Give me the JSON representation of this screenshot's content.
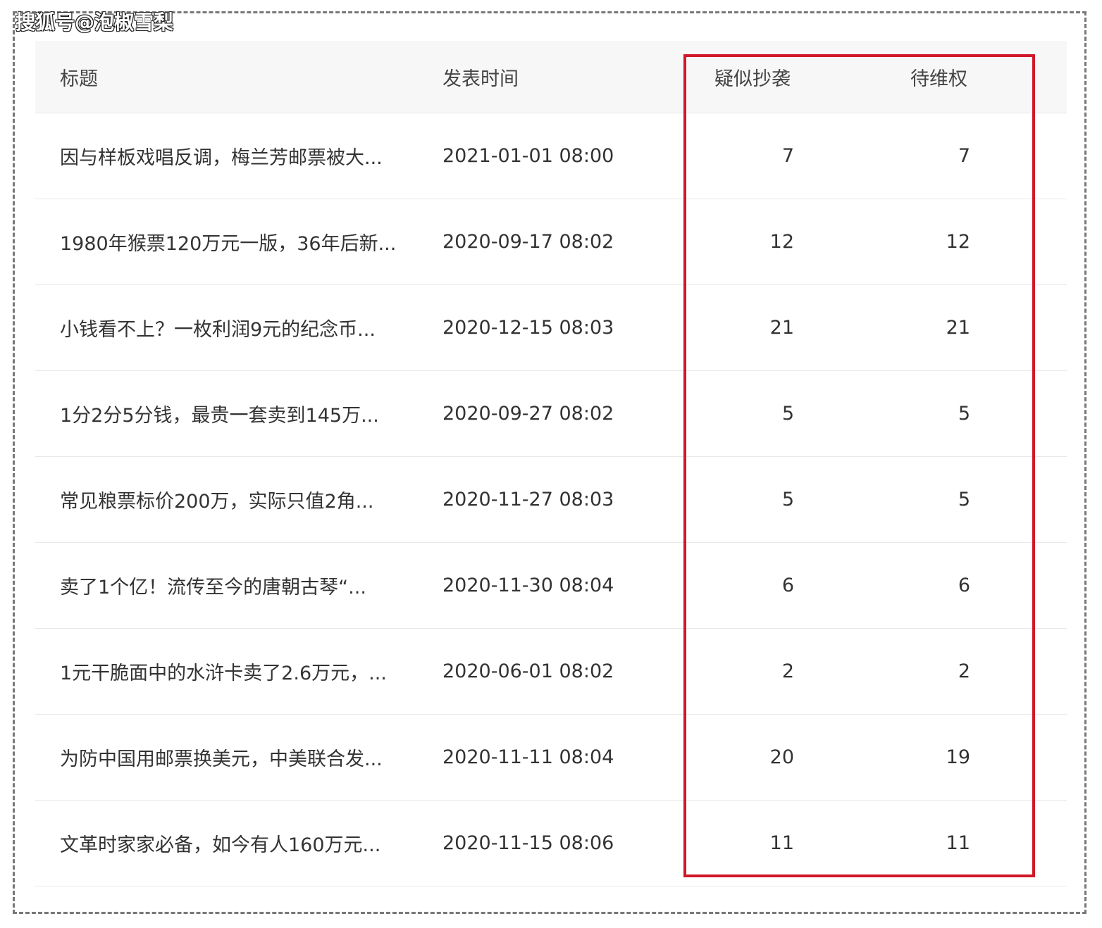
{
  "watermark": "搜狐号@泡椒雪梨",
  "headers": {
    "title": "标题",
    "time": "发表时间",
    "suspected": "疑似抄袭",
    "pending": "待维权"
  },
  "highlight_color": "#d0182a",
  "rows": [
    {
      "title": "因与样板戏唱反调，梅兰芳邮票被大...",
      "time": "2021-01-01 08:00",
      "suspected": "7",
      "pending": "7"
    },
    {
      "title": "1980年猴票120万元一版，36年后新...",
      "time": "2020-09-17 08:02",
      "suspected": "12",
      "pending": "12"
    },
    {
      "title": "小钱看不上？一枚利润9元的纪念币...",
      "time": "2020-12-15 08:03",
      "suspected": "21",
      "pending": "21"
    },
    {
      "title": "1分2分5分钱，最贵一套卖到145万...",
      "time": "2020-09-27 08:02",
      "suspected": "5",
      "pending": "5"
    },
    {
      "title": "常见粮票标价200万，实际只值2角...",
      "time": "2020-11-27 08:03",
      "suspected": "5",
      "pending": "5"
    },
    {
      "title": "卖了1个亿！流传至今的唐朝古琴“...",
      "time": "2020-11-30 08:04",
      "suspected": "6",
      "pending": "6"
    },
    {
      "title": "1元干脆面中的水浒卡卖了2.6万元，...",
      "time": "2020-06-01 08:02",
      "suspected": "2",
      "pending": "2"
    },
    {
      "title": "为防中国用邮票换美元，中美联合发...",
      "time": "2020-11-11 08:04",
      "suspected": "20",
      "pending": "19"
    },
    {
      "title": "文革时家家必备，如今有人160万元...",
      "time": "2020-11-15 08:06",
      "suspected": "11",
      "pending": "11"
    }
  ]
}
